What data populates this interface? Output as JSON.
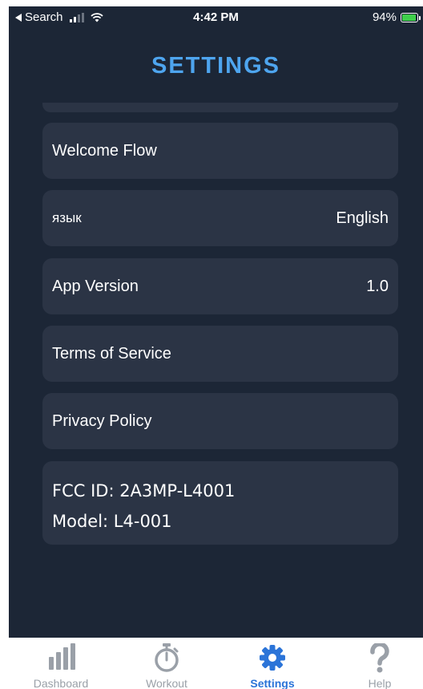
{
  "status_bar": {
    "back_label": "Search",
    "time": "4:42 PM",
    "battery": "94%"
  },
  "header": {
    "title": "SETTINGS"
  },
  "settings": {
    "welcome_flow": {
      "label": "Welcome Flow"
    },
    "language": {
      "label": "язык",
      "value": "English"
    },
    "app_version": {
      "label": "App Version",
      "value": "1.0"
    },
    "terms": {
      "label": "Terms of Service"
    },
    "privacy": {
      "label": "Privacy Policy"
    },
    "device_info": {
      "fcc_id": "FCC ID: 2A3MP-L4001",
      "model": "Model: L4-001"
    }
  },
  "tab_bar": {
    "active": "Settings",
    "tabs": [
      {
        "label": "Dashboard",
        "icon": "bar-chart-icon"
      },
      {
        "label": "Workout",
        "icon": "stopwatch-icon"
      },
      {
        "label": "Settings",
        "icon": "gear-icon"
      },
      {
        "label": "Help",
        "icon": "question-mark-icon"
      }
    ]
  },
  "colors": {
    "background": "#1c2636",
    "card": "#2b3445",
    "accent": "#4ea5ef",
    "tab_active": "#2b74d8",
    "tab_inactive": "#9aa0a8"
  }
}
